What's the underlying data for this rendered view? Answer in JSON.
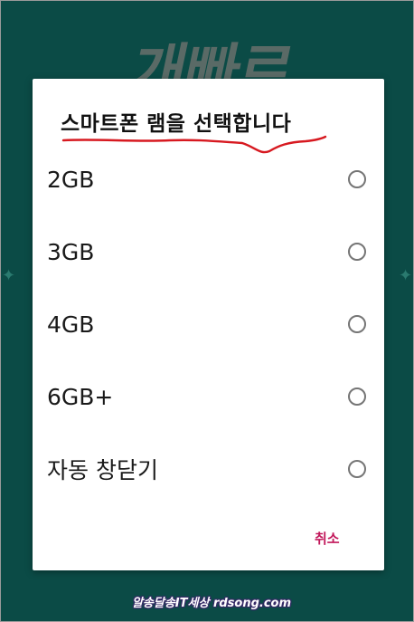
{
  "background": {
    "logo_text": "개빠르",
    "color": "#0b4b46"
  },
  "dialog": {
    "title": "스마트폰 램을 선택합니다",
    "title_underline_color": "#d71920",
    "options": [
      {
        "label": "2GB",
        "selected": false
      },
      {
        "label": "3GB",
        "selected": false
      },
      {
        "label": "4GB",
        "selected": false
      },
      {
        "label": "6GB+",
        "selected": false
      },
      {
        "label": "자동 창닫기",
        "selected": false
      }
    ],
    "cancel_label": "취소",
    "accent_color": "#c2185b"
  },
  "watermark": {
    "text": "알송달송IT세상 rdsong.com"
  }
}
